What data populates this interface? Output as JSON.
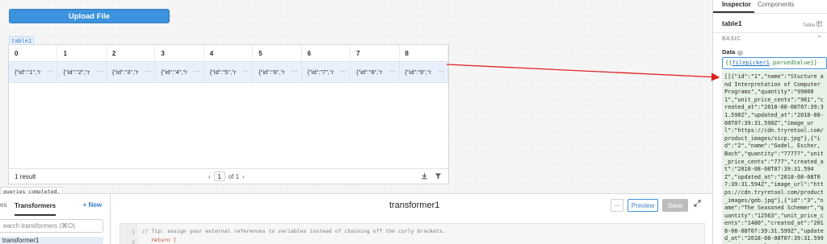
{
  "canvas": {
    "upload_button": "Upload File",
    "table_tag": "table1",
    "table": {
      "columns": [
        "0",
        "1",
        "2",
        "3",
        "4",
        "5",
        "6",
        "7",
        "8"
      ],
      "row": [
        "{\"id\":\"1\",\"r",
        "{\"id\":\"2\",\"r",
        "{\"id\":\"3\",\"r",
        "{\"id\":\"4\",\"r",
        "{\"id\":\"5\",\"r",
        "{\"id\":\"6\",\"r",
        "{\"id\":\"7\",\"r",
        "{\"id\":\"8\",\"r",
        "{\"id\":\"9\",\"r"
      ],
      "cell_menu": "···",
      "result_count": "1 result",
      "page_current": "1",
      "page_total": "of 1",
      "prev_glyph": "‹",
      "next_glyph": "›"
    },
    "queries_status": "queries completed."
  },
  "bottom_left": {
    "tab_queries": "es",
    "tab_transformers": "Transformers",
    "new_label": "+ New",
    "search_placeholder": "earch transformers (⌘O)",
    "item": "transformer1"
  },
  "bottom_main": {
    "title": "transformer1",
    "more_label": "···",
    "preview_label": "Preview",
    "save_label": "Save",
    "gutter_1": "1",
    "gutter_2": "2",
    "code_comment": "// Tip: assign your external references to variables instead of chaining off the curly brackets.",
    "code_line2": "return ["
  },
  "inspector": {
    "tab_inspector": "Inspector",
    "tab_components": "Components",
    "component_name": "table1",
    "component_type": "Table",
    "section": "BASIC",
    "data_label": "Data",
    "data_value_prefix": "{{",
    "data_value_ref": "filepicker1",
    "data_value_suffix": ".parsedValue}}",
    "data_preview": "[[{\"id\":\"1\",\"name\":\"Stucture and Interpretation of Computer Programs\",\"quantity\":\"998001\",\"unit_price_cents\":\"961\",\"created_at\":\"2018-08-08T07:39:31.590Z\",\"updated_at\":\"2018-08-08T07:39:31.590Z\",\"image_url\":\"https://cdn.tryretool.com/product_images/sicp.jpg\"},{\"id\":\"2\",\"name\":\"Godel, Escher, Bach\",\"quantity\":\"77777\",\"unit_price_cents\":\"777\",\"created_at\":\"2018-08-08T07:39:31.594Z\",\"updated_at\":\"2018-08-08T07:39:31.594Z\",\"image_url\":\"https://cdn.tryretool.com/product_images/geb.jpg\"},{\"id\":\"3\",\"name\":\"The Seasoned Schemer\",\"quantity\":\"12563\",\"unit_price_cents\":\"1480\",\"created_at\":\"2018-08-08T07:39:31.599Z\",\"updated_at\":\"2018-08-08T07:39:31.599Z\",\"image_url\":\"https://cdn.tryretool.com/product"
  },
  "colors": {
    "accent": "#3c92dc",
    "arrow": "#e02020",
    "preview_bg": "#e6f2e3"
  }
}
